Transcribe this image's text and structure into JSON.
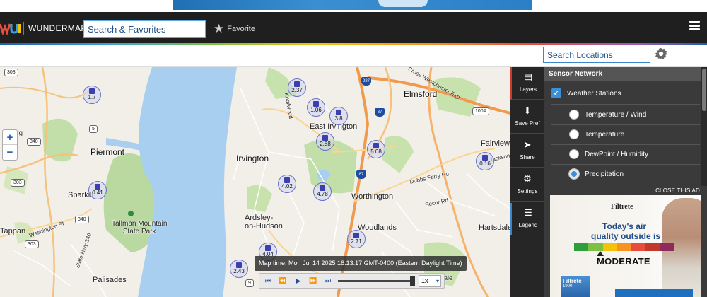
{
  "app": {
    "title": "WUNDERMAP",
    "logo": "wu-logo"
  },
  "header": {
    "search_placeholder": "Search & Favorites",
    "favorite_label": "Favorite",
    "favorite_icon": "star-icon",
    "menu_icon": "hamburger-icon"
  },
  "toolbar": {
    "search_locations_placeholder": "Search Locations",
    "settings_icon": "gear-icon"
  },
  "map": {
    "places": {
      "piermont": "Piermont",
      "irvington": "Irvington",
      "elmsford": "Elmsford",
      "east_irvington": "East Irvington",
      "worthington": "Worthington",
      "fairview": "Fairview",
      "sparkill": "Sparkill",
      "tallman": "Tallman Mountain\nState Park",
      "ardsley": "Ardsley-\non-Hudson",
      "woodlands": "Woodlands",
      "tappan": "Tappan",
      "hartsdale": "Hartsdale",
      "palisades": "Palisades",
      "sunningdale": "Sunningdale"
    },
    "roads": {
      "cross_westchester": "Cross Westchester Exp",
      "dobbs_ferry": "Dobbs Ferry Rd",
      "secor": "Secor Rd",
      "washington": "Washington St",
      "state_hwy": "State Hwy 340",
      "knollwood": "Knollwood",
      "jackson": "Jackson Ave",
      "berg": "berg"
    },
    "shields": [
      "303",
      "5",
      "340",
      "303",
      "340",
      "303",
      "287",
      "87",
      "87",
      "100A",
      "9"
    ],
    "stations": [
      "1.7",
      "2.37",
      "1.06",
      "3.8",
      "2.88",
      "5.08",
      "0.16",
      "4.02",
      "4.78",
      "0.41",
      "2.71",
      "4.04",
      "2.43"
    ],
    "zoom": {
      "in": "+",
      "out": "−"
    },
    "map_time": "Map time: Mon Jul 14 2025 18:13:17 GMT-0400 (Eastern Daylight Time)",
    "playback": {
      "speed": "1x",
      "buttons": [
        "skip-start-icon",
        "rewind-icon",
        "play-icon",
        "fast-forward-icon",
        "skip-end-icon"
      ]
    }
  },
  "rail": [
    {
      "label": "Layers",
      "icon": "layers-icon"
    },
    {
      "label": "Save Pref",
      "icon": "download-icon"
    },
    {
      "label": "Share",
      "icon": "share-icon"
    },
    {
      "label": "Settings",
      "icon": "gear-icon"
    },
    {
      "label": "Legend",
      "icon": "list-icon"
    }
  ],
  "panel": {
    "title": "Sensor Network",
    "weather_stations": "Weather Stations",
    "options": [
      {
        "label": "Temperature / Wind",
        "selected": false
      },
      {
        "label": "Temperature",
        "selected": false
      },
      {
        "label": "DewPoint / Humidity",
        "selected": false
      },
      {
        "label": "Precipitation",
        "selected": true
      }
    ]
  },
  "ad": {
    "close_label": "CLOSE THIS AD",
    "brand": "Filtrete",
    "headline_1": "Today's air",
    "headline_2": "quality outside is",
    "level": "MODERATE",
    "box_brand": "Filtrete",
    "box_number": "1900",
    "aqi_colors": [
      "#2e9e3a",
      "#7cc142",
      "#f4c20d",
      "#f7931e",
      "#e84c3d",
      "#c0392b",
      "#8e2b5a"
    ]
  }
}
